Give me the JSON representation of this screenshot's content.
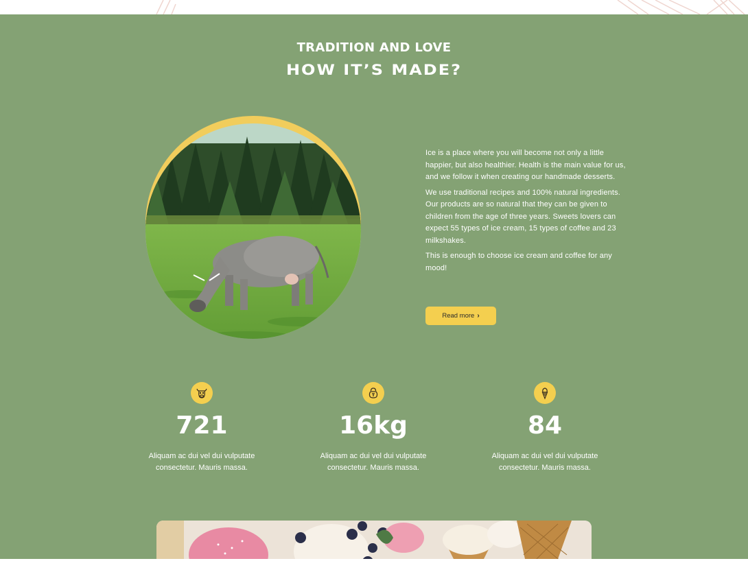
{
  "section": {
    "eyebrow": "TRADITION AND LOVE",
    "title": "HOW IT’S MADE?",
    "background_color": "#84a274",
    "accent_color": "#f4cf4f"
  },
  "feature_image": {
    "subject": "cow grazing on a meadow in front of a pine forest"
  },
  "copy": {
    "paragraphs": [
      "Ice is a place where you will become not only a little happier, but also healthier. Health is the main value for us, and we follow it when creating our handmade desserts.",
      "We use traditional recipes and 100% natural ingredients. Our products are so natural that they can be given to children from the age of three years. Sweets lovers can expect 55 types of ice cream, 15 types of coffee and 23 milkshakes.",
      "This is enough to choose ice cream and coffee for any mood!"
    ],
    "button_label": "Read more",
    "button_icon": "chevron-right-icon"
  },
  "stats": [
    {
      "icon": "cow-icon",
      "value": "721",
      "description": "Aliquam ac dui vel dui vulputate consectetur. Mauris massa."
    },
    {
      "icon": "kettlebell-icon",
      "value": "16kg",
      "description": "Aliquam ac dui vel dui vulputate consectetur. Mauris massa."
    },
    {
      "icon": "ice-cream-icon",
      "value": "84",
      "description": "Aliquam ac dui vel dui vulputate consectetur. Mauris massa."
    }
  ],
  "bottom_image": {
    "subject": "ice cream scoops, cones and blueberries"
  }
}
